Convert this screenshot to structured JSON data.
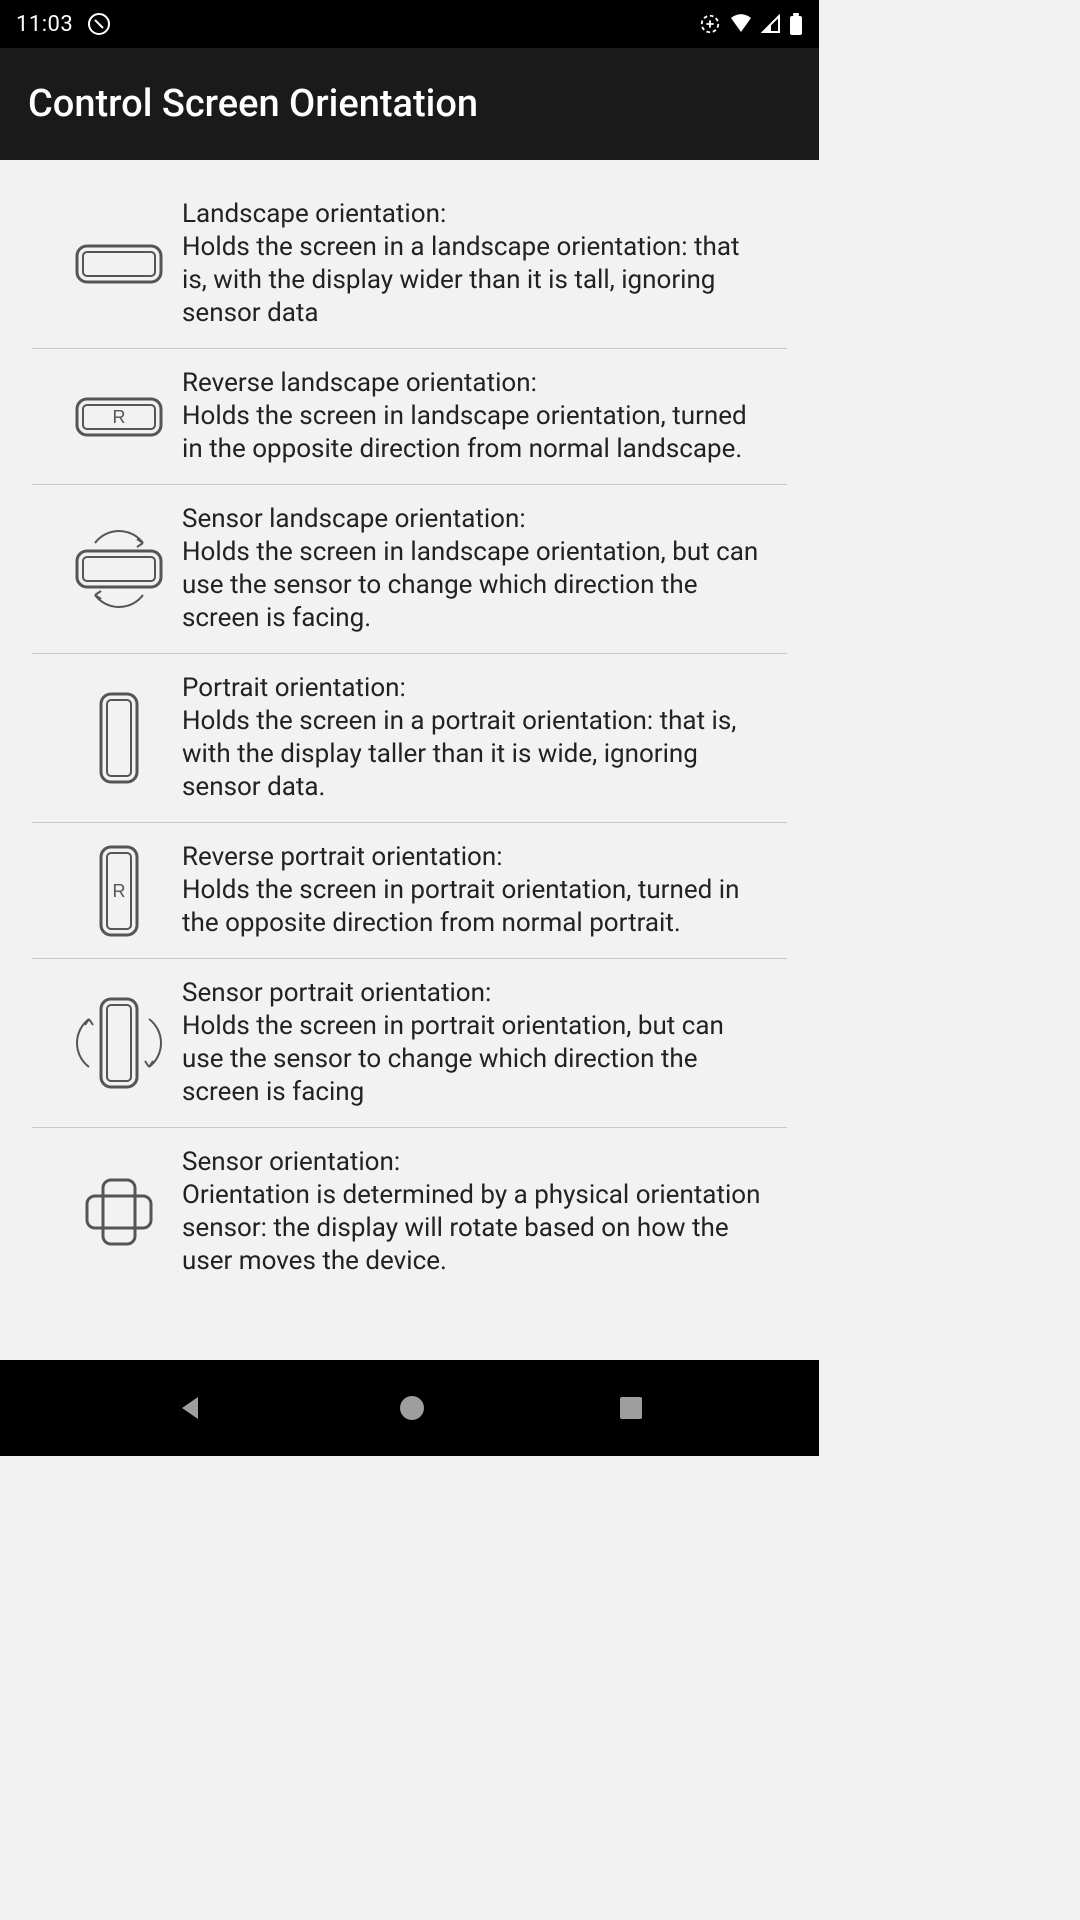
{
  "status": {
    "time": "11:03"
  },
  "header": {
    "title": "Control Screen Orientation"
  },
  "items": [
    {
      "title": "Landscape orientation:",
      "desc": "Holds the screen in a landscape orientation: that is, with the display wider than it is tall, ignoring sensor data"
    },
    {
      "title": "Reverse landscape orientation:",
      "desc": "Holds the screen in landscape orientation, turned in the opposite direction from normal landscape."
    },
    {
      "title": "Sensor landscape orientation:",
      "desc": "Holds the screen in landscape orientation, but can use the sensor to change which direction the screen is facing."
    },
    {
      "title": "Portrait orientation:",
      "desc": "Holds the screen in a portrait orientation: that is, with the display taller than it is wide, ignoring sensor data."
    },
    {
      "title": "Reverse portrait orientation:",
      "desc": "Holds the screen in portrait orientation, turned in the opposite direction from normal portrait."
    },
    {
      "title": "Sensor portrait orientation:",
      "desc": "Holds the screen in portrait orientation, but can use the sensor to change which direction the screen is facing"
    },
    {
      "title": "Sensor orientation:",
      "desc": "Orientation is determined by a physical orientation sensor: the display will rotate based on how the user moves the device."
    }
  ]
}
